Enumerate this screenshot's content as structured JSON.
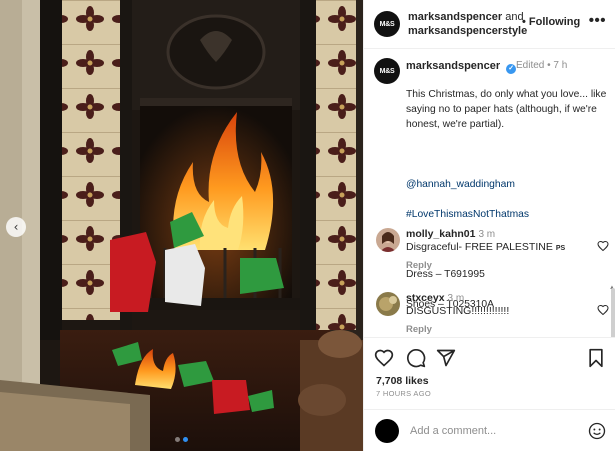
{
  "header": {
    "account_line1": "marksandspencer",
    "and_word": "and",
    "account_line2": "marksandspencerstyle",
    "follow_label": "• Following",
    "more_label": "•••",
    "avatar_text": "M&S"
  },
  "caption": {
    "user": "marksandspencer",
    "edited": "Edited • 7 h",
    "body": "This Christmas, do only what you love... like saying no to paper hats (although, if we're honest, we're partial).",
    "mention": "@hannah_waddingham",
    "hashtag": "#LoveThismasNotThatmas",
    "dress": "Dress – T691995",
    "shoes": "Shoes – T025310A"
  },
  "comments": [
    {
      "user": "molly_kahn01",
      "time": "3 m",
      "text": "Disgraceful- FREE PALESTINE",
      "flag": "PS",
      "reply": "Reply"
    },
    {
      "user": "stxceyx",
      "time": "3 m",
      "text": "DISGUSTING!!!!!!!!!!!!!",
      "reply": "Reply"
    }
  ],
  "stats": {
    "likes": "7,708 likes",
    "ago": "7 HOURS AGO"
  },
  "add_comment": {
    "placeholder": "Add a comment..."
  },
  "colors": {
    "link": "#00376b",
    "verified": "#3897f0",
    "muted": "#8e8e8e",
    "dot_active": "#2f8ff1"
  },
  "icons": [
    "chevron-left-icon",
    "heart-icon",
    "comment-icon",
    "share-icon",
    "bookmark-icon",
    "emoji-icon",
    "verified-icon"
  ]
}
